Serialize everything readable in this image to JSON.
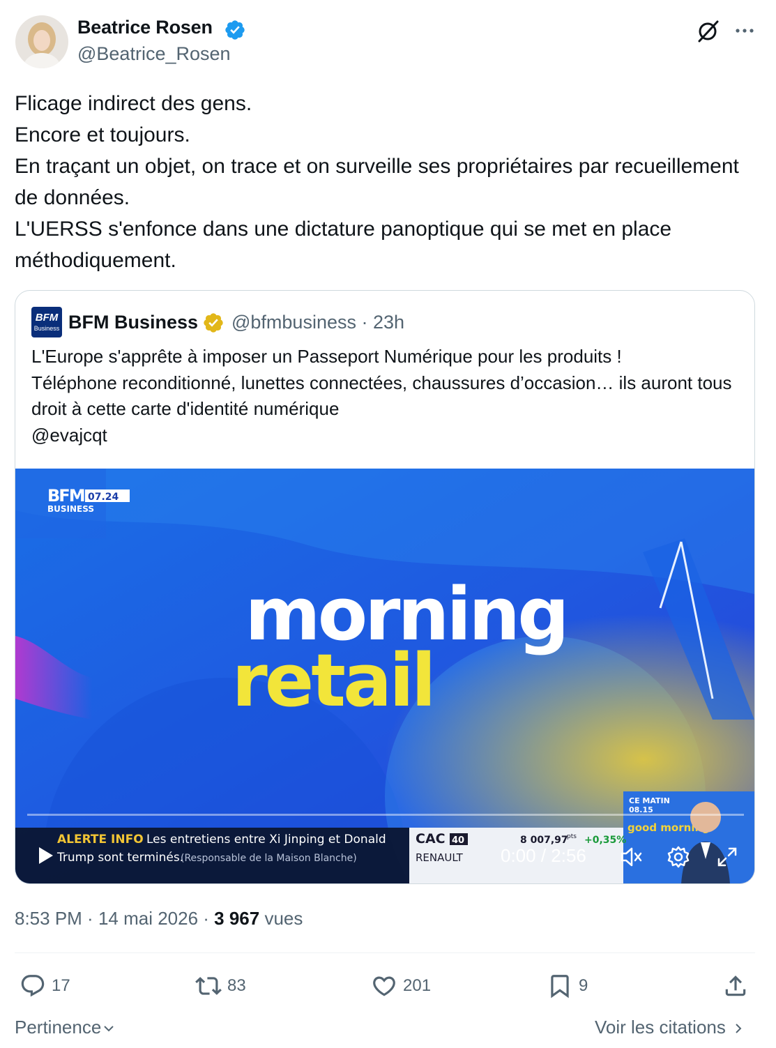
{
  "author": {
    "name": "Beatrice Rosen",
    "handle": "@Beatrice_Rosen",
    "verified_color": "#1d9bf0"
  },
  "tweet": {
    "text": "Flicage indirect des gens.\nEncore et toujours.\nEn traçant un objet, on trace et on surveille ses propriétaires par recueillement de données.\nL'UERSS s'enfonce dans une dictature panoptique qui se met en place méthodiquement."
  },
  "quote": {
    "name": "BFM Business",
    "handle": "@bfmbusiness",
    "age": "23h",
    "meta": "@bfmbusiness · 23h",
    "verified_color": "#e2b719",
    "logo_text": "BFM",
    "logo_sub": "Business",
    "text": "L'Europe s'apprête à imposer un Passeport Numérique pour les produits !\nTéléphone reconditionné, lunettes connectées, chaussures d’occasion… ils auront tous droit à cette carte d'identité numérique\n@evajcqt"
  },
  "video": {
    "channel_logo": "BFM",
    "channel_sub": "BUSINESS",
    "clock": "07.24",
    "title_line1": "morning",
    "title_line2": "retail",
    "ticker_label": "ALERTE INFO",
    "ticker_line1": "Les entretiens entre Xi Jinping et Donald",
    "ticker_line2": "Trump sont terminés.",
    "ticker_source": "(Responsable de la Maison Blanche)",
    "market_index": "CAC",
    "market_index_num": "40",
    "market_value": "8 007,97",
    "market_unit": "pts",
    "market_change": "+0,35%",
    "market_stock": "RENAULT",
    "promo_line1": "CE MATIN",
    "promo_time": "08.15",
    "promo_show": "good morning",
    "time_display": "0:00 / 2:56",
    "progress": 0
  },
  "timestamp": {
    "time": "8:53 PM",
    "date": "14 mai 2026",
    "views": "3 967",
    "views_label": "vues"
  },
  "actions": {
    "replies": "17",
    "reposts": "83",
    "likes": "201",
    "bookmarks": "9"
  },
  "footer": {
    "sort_label": "Pertinence",
    "quotes_label": "Voir les citations"
  }
}
